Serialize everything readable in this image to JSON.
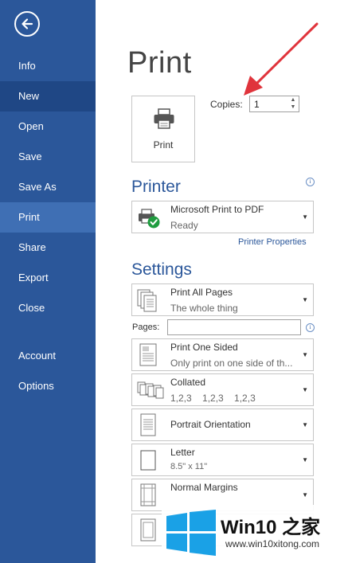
{
  "sidebar": {
    "items": [
      {
        "label": "Info"
      },
      {
        "label": "New"
      },
      {
        "label": "Open"
      },
      {
        "label": "Save"
      },
      {
        "label": "Save As"
      },
      {
        "label": "Print"
      },
      {
        "label": "Share"
      },
      {
        "label": "Export"
      },
      {
        "label": "Close"
      },
      {
        "label": "Account"
      },
      {
        "label": "Options"
      }
    ],
    "active": "Print",
    "colors": {
      "background": "#2b579a",
      "selected": "#3f6fb4",
      "hover": "#1f4785"
    }
  },
  "main": {
    "title": "Print",
    "print_button": "Print",
    "copies_label": "Copies:",
    "copies_value": "1",
    "printer_section": "Printer",
    "printer": {
      "name": "Microsoft Print to PDF",
      "status": "Ready"
    },
    "printer_properties": "Printer Properties",
    "settings_section": "Settings",
    "pages_label": "Pages:",
    "pages_value": "",
    "settings": [
      {
        "line1": "Print All Pages",
        "line2": "The whole thing"
      },
      {
        "line1": "Print One Sided",
        "line2": "Only print on one side of th..."
      },
      {
        "line1": "Collated",
        "line2": "1,2,3    1,2,3    1,2,3"
      },
      {
        "line1": "Portrait Orientation",
        "line2": ""
      },
      {
        "line1": "Letter",
        "line2": "8.5\" x 11\""
      },
      {
        "line1": "Normal Margins",
        "line2": ""
      }
    ]
  },
  "watermark": {
    "title": "Win10 之家",
    "url": "www.win10xitong.com"
  },
  "colors": {
    "accent": "#2b579a",
    "annotation_arrow": "#e0343c"
  }
}
